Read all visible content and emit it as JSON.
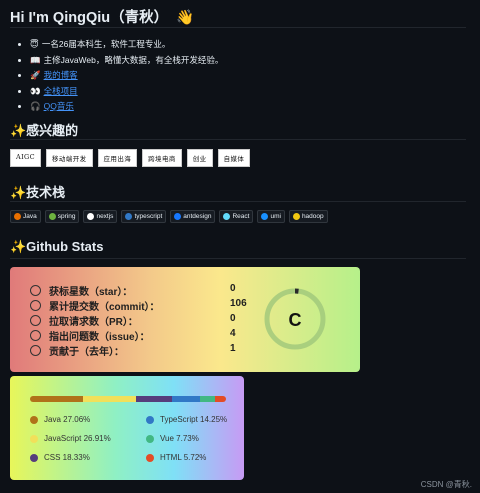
{
  "header": {
    "title": "Hi I'm QingQiu（青秋）",
    "wave_emoji": "👋"
  },
  "intro": [
    {
      "emoji": "😇",
      "text": "一名26届本科生，软件工程专业。",
      "link": false
    },
    {
      "emoji": "📖",
      "text": "主修JavaWeb，略懂大数据，有全栈开发经验。",
      "link": false
    },
    {
      "emoji": "🚀",
      "text": "我的博客",
      "link": true
    },
    {
      "emoji": "👀",
      "text": "全栈项目",
      "link": true
    },
    {
      "emoji": "🎧",
      "text": "QQ音乐",
      "link": true
    }
  ],
  "interests": {
    "heading": "✨感兴趣的",
    "tags": [
      "AIGC",
      "移动端开发",
      "应用出海",
      "跨境电商",
      "创业",
      "自媒体"
    ]
  },
  "tech": {
    "heading": "✨技术栈",
    "badges": [
      {
        "label": "Java",
        "icon": "java-icon",
        "color": "#e76f00"
      },
      {
        "label": "spring",
        "icon": "spring-icon",
        "color": "#6db33f"
      },
      {
        "label": "nextjs",
        "icon": "nextjs-icon",
        "color": "#ffffff"
      },
      {
        "label": "typescript",
        "icon": "typescript-icon",
        "color": "#3178c6"
      },
      {
        "label": "antdesign",
        "icon": "antdesign-icon",
        "color": "#1677ff"
      },
      {
        "label": "React",
        "icon": "react-icon",
        "color": "#61dafb"
      },
      {
        "label": "umi",
        "icon": "umi-icon",
        "color": "#1890ff"
      },
      {
        "label": "hadoop",
        "icon": "hadoop-icon",
        "color": "#f2c811"
      }
    ]
  },
  "github": {
    "heading": "✨Github Stats",
    "stats": [
      {
        "label": "获标星数（star）：",
        "value": "0",
        "icon": "star-icon"
      },
      {
        "label": "累计提交数（commit）：",
        "value": "106",
        "icon": "history-icon"
      },
      {
        "label": "拉取请求数（PR）：",
        "value": "0",
        "icon": "pull-request-icon"
      },
      {
        "label": "指出问题数（issue）：",
        "value": "4",
        "icon": "issue-icon"
      },
      {
        "label": "贡献于（去年）：",
        "value": "1",
        "icon": "repo-icon"
      }
    ],
    "rank": "C",
    "rank_progress": 0.02
  },
  "languages": {
    "items": [
      {
        "name": "Java 27.06%",
        "pct": 27.06,
        "color": "#b07219"
      },
      {
        "name": "TypeScript 14.25%",
        "pct": 14.25,
        "color": "#3178c6"
      },
      {
        "name": "JavaScript 26.91%",
        "pct": 26.91,
        "color": "#f1e05a"
      },
      {
        "name": "Vue 7.73%",
        "pct": 7.73,
        "color": "#41b883"
      },
      {
        "name": "CSS 18.33%",
        "pct": 18.33,
        "color": "#563d7c"
      },
      {
        "name": "HTML 5.72%",
        "pct": 5.72,
        "color": "#e34c26"
      }
    ],
    "bar_order": [
      0,
      2,
      4,
      1,
      3,
      5
    ]
  },
  "footer": "CSDN @青秋."
}
